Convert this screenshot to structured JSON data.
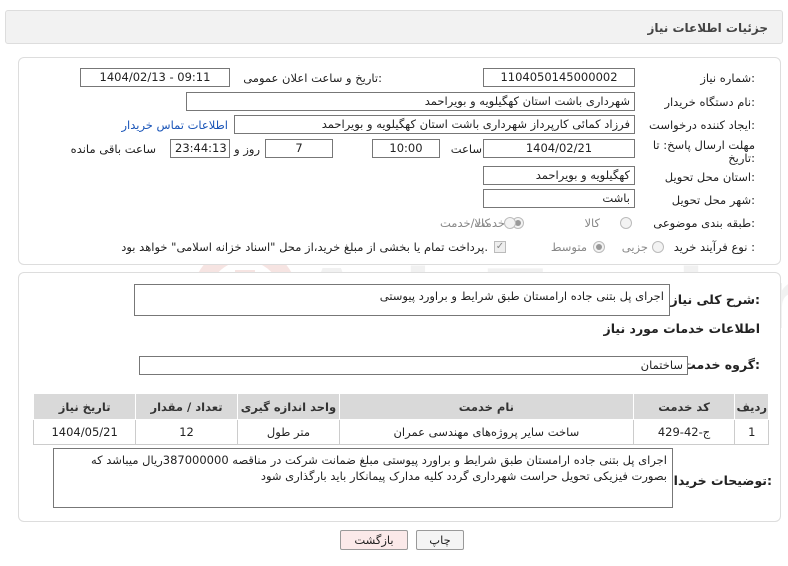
{
  "header": {
    "title": "جزئیات اطلاعات نیاز"
  },
  "form": {
    "need_number_label": "شماره نیاز:",
    "need_number": "1104050145000002",
    "announce_label": "تاریخ و ساعت اعلان عمومی:",
    "announce_value": "1404/02/13 - 09:11",
    "buyer_org_label": "نام دستگاه خریدار:",
    "buyer_org": "شهرداری باشت استان کهگیلویه و بویراحمد",
    "creator_label": "ایجاد کننده درخواست:",
    "creator": "فرزاد کمائی کارپرداز شهرداری باشت استان کهگیلویه و بویراحمد",
    "contact_link": "اطلاعات تماس خریدار",
    "deadline_label_1": "مهلت ارسال پاسخ: تا",
    "deadline_label_2": "تاریخ:",
    "deadline_date": "1404/02/21",
    "time_label": "ساعت",
    "deadline_time": "10:00",
    "days_value": "7",
    "days_label": "روز و",
    "remaining_time": "23:44:13",
    "remaining_label": "ساعت باقی مانده",
    "province_label": "استان محل تحویل:",
    "province": "کهگیلویه و بویراحمد",
    "city_label": "شهر محل تحویل:",
    "city": "باشت",
    "category_label": "طبقه بندی موضوعی:",
    "category_options": [
      "کالا",
      "خدمت",
      "کالا/خدمت"
    ],
    "category_selected": "خدمت",
    "process_label": "نوع فرآیند خرید :",
    "process_options": [
      "جزیی",
      "متوسط"
    ],
    "process_selected": "متوسط",
    "payment_note": "پرداخت تمام یا بخشی از مبلغ خرید،از محل \"اسناد خزانه اسلامی\" خواهد بود."
  },
  "details": {
    "description_label": "شرح کلی نیاز:",
    "description": "اجرای پل بتنی جاده ارامستان طبق شرایط و براورد پیوستی",
    "services_title": "اطلاعات خدمات مورد نیاز",
    "service_group_label": "گروه خدمت:",
    "service_group": "ساختمان",
    "table": {
      "headers": [
        "ردیف",
        "کد خدمت",
        "نام خدمت",
        "واحد اندازه گیری",
        "تعداد / مقدار",
        "تاریخ نیاز"
      ],
      "rows": [
        [
          "1",
          "ج-42-429",
          "ساخت سایر پروژه‌های مهندسی عمران",
          "متر طول",
          "12",
          "1404/05/21"
        ]
      ]
    },
    "buyer_notes_label": "توضیحات خریدار:",
    "buyer_notes": "اجرای پل بتنی جاده ارامستان طبق شرایط و براورد پیوستی مبلغ ضمانت شرکت در مناقصه 387000000ریال میباشد که بصورت فیزیکی تحویل حراست شهرداری گردد کلیه مدارک پیمانکار باید بارگذاری شود"
  },
  "buttons": {
    "print": "چاپ",
    "back": "بازگشت"
  },
  "watermark": "AriaTender.neT",
  "colors": {
    "link": "#1a55b8",
    "header_bg": "#f2f2f2",
    "table_header": "#d9d9d9",
    "back_button_bg": "#fbe9e9"
  }
}
